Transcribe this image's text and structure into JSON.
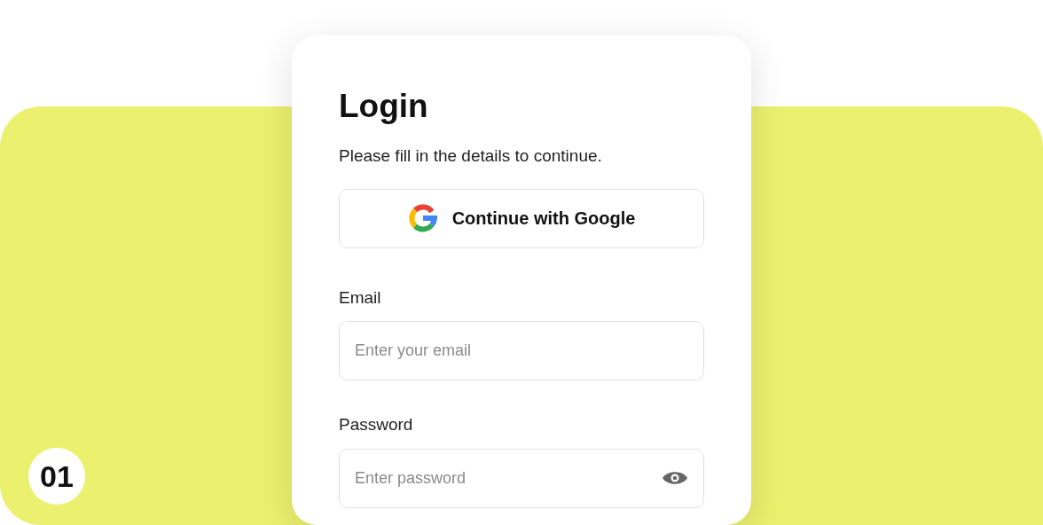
{
  "step_badge": "01",
  "login": {
    "title": "Login",
    "subtitle": "Please fill in the details to continue.",
    "google_button": "Continue with Google",
    "fields": [
      {
        "kind": "email",
        "label": "Email",
        "placeholder": "Enter your email"
      },
      {
        "kind": "password",
        "label": "Password",
        "placeholder": "Enter password"
      }
    ]
  }
}
